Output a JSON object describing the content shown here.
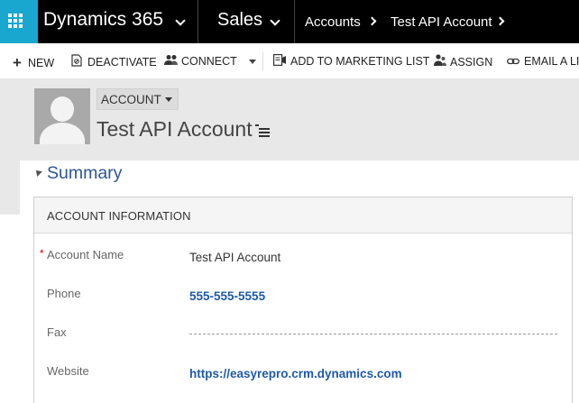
{
  "topbar": {
    "app_launcher_icon": "waffle-grid-icon",
    "app_name": "Dynamics 365",
    "area_name": "Sales",
    "breadcrumbs": [
      "Accounts",
      "Test API Account"
    ],
    "accent_color": "#1aa7cf"
  },
  "commands": {
    "new": {
      "label": "NEW",
      "icon": "plus-icon"
    },
    "deactivate": {
      "label": "DEACTIVATE",
      "icon": "deactivate-document-icon"
    },
    "connect": {
      "label": "CONNECT",
      "icon": "people-connect-icon"
    },
    "add_to_marketing_list": {
      "label": "ADD TO MARKETING LIST",
      "icon": "marketing-list-icon"
    },
    "assign": {
      "label": "ASSIGN",
      "icon": "assign-people-icon"
    },
    "email_link": {
      "label": "EMAIL A LIN",
      "icon": "link-icon"
    }
  },
  "header": {
    "entity_type": "ACCOUNT",
    "record_name": "Test API Account"
  },
  "form": {
    "section_title": "Summary",
    "card_title": "ACCOUNT INFORMATION",
    "fields": {
      "account_name": {
        "label": "Account Name",
        "value": "Test API Account",
        "required_marker": "*"
      },
      "phone": {
        "label": "Phone",
        "value": "555-555-5555"
      },
      "fax": {
        "label": "Fax",
        "value": ""
      },
      "website": {
        "label": "Website",
        "value": "https://easyrepro.crm.dynamics.com"
      }
    },
    "link_color": "#1f5aa8",
    "required_color": "#cc0000"
  }
}
